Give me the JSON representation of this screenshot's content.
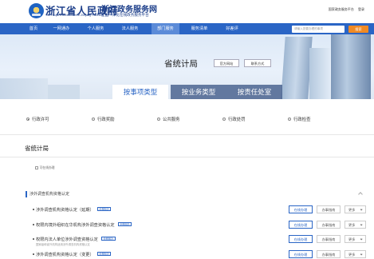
{
  "header": {
    "site_title": "浙江省人民政府",
    "site_subtitle": "The People's Government of Zhejiang Province",
    "service_title": "浙江政务服务网",
    "service_subtitle": "全国一体化在线政务服务平台",
    "top_links": [
      "国家政务服务平台",
      "登录"
    ]
  },
  "nav": {
    "items": [
      "首页",
      "一网通办",
      "个人服务",
      "法人服务",
      "部门服务",
      "服务清单",
      "好差评"
    ],
    "active_index": 4,
    "search_placeholder": "请输入您要办理的事项",
    "search_button": "搜索"
  },
  "banner": {
    "title": "省统计局",
    "official_site_button": "官方网站",
    "contact_button": "联系方式",
    "tabs": [
      "按事项类型",
      "按业务类型",
      "按责任处室"
    ],
    "active_tab": 0
  },
  "categories": {
    "items": [
      "行政许可",
      "行政奖励",
      "公共服务",
      "行政处罚",
      "行政检查"
    ],
    "selected_index": 0
  },
  "section": {
    "title": "省统计局",
    "filter_label": "可在线办理"
  },
  "group": {
    "title": "涉外调查机构资格认定"
  },
  "rows": [
    {
      "name": "涉外调查机构资格认定（延期）",
      "tag": "全程网办",
      "note": ""
    },
    {
      "name": "权限内境外组织在华机构涉外调查资格认定",
      "tag": "全程网办",
      "note": ""
    },
    {
      "name": "权限内法人单位涉外调查资格认定",
      "tag": "全程网办",
      "note": "国家级和省外机构适用涉外调查机构资格认定"
    },
    {
      "name": "涉外调查机构资格认定（变更）",
      "tag": "全程网办",
      "note": ""
    }
  ],
  "row_buttons": {
    "online": "在线办理",
    "guide": "办事指南",
    "more": "更多"
  },
  "colors": {
    "nav_blue": "#2a65c5",
    "search_orange": "#f08a24",
    "title_blue": "#1d3f8a"
  }
}
